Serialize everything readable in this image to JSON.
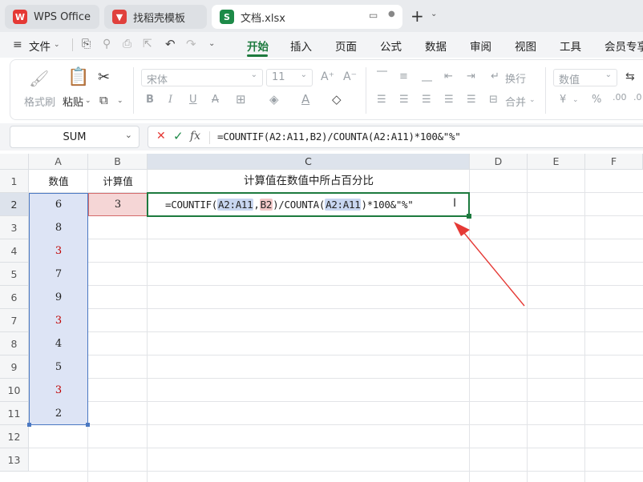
{
  "tabs": [
    {
      "label": "WPS Office",
      "icon": "wps-logo-icon"
    },
    {
      "label": "找稻壳模板",
      "icon": "docer-icon"
    },
    {
      "label": "文档.xlsx",
      "icon": "spreadsheet-icon"
    }
  ],
  "menu": {
    "file": "文件",
    "items": [
      "开始",
      "插入",
      "页面",
      "公式",
      "数据",
      "审阅",
      "视图",
      "工具",
      "会员专享"
    ],
    "active": "开始"
  },
  "ribbon": {
    "format_painter": "格式刷",
    "paste": "粘贴",
    "font_name": "宋体",
    "font_size": "11",
    "wrap": "换行",
    "merge": "合并",
    "number_format": "数值",
    "currency": "¥",
    "percent": "%"
  },
  "formula_bar": {
    "name_box": "SUM",
    "formula": "=COUNTIF(A2:A11,B2)/COUNTA(A2:A11)*100&\"%\""
  },
  "columns": [
    "A",
    "B",
    "C",
    "D",
    "E",
    "F"
  ],
  "rows": [
    "1",
    "2",
    "3",
    "4",
    "5",
    "6",
    "7",
    "8",
    "9",
    "10",
    "11",
    "12",
    "13"
  ],
  "cells": {
    "a1": "数值",
    "b1": "计算值",
    "c1": "计算值在数值中所占百分比",
    "b2": "3",
    "a_values": [
      "6",
      "8",
      "3",
      "7",
      "9",
      "3",
      "4",
      "5",
      "3",
      "2"
    ],
    "c2_parts": {
      "eq": "=COUNTIF(",
      "r1": "A2:A11",
      "comma": ",",
      "r2": "B2",
      "mid": ")/COUNTA(",
      "r3": "A2:A11",
      "tail": ")*100&\"%\""
    }
  },
  "colors": {
    "accent": "#1d7a3e",
    "highlight_red": "#c00000",
    "arrow": "#e53935"
  }
}
